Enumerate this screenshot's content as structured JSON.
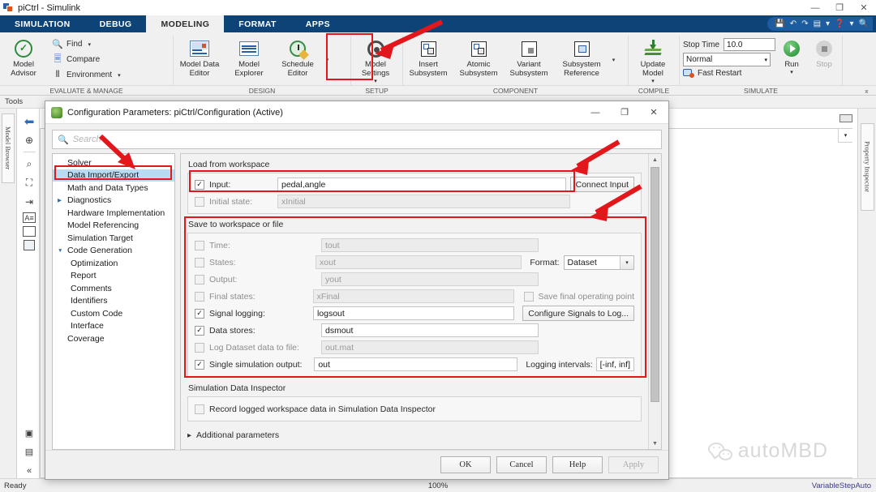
{
  "window": {
    "title": "piCtrl - Simulink",
    "minimize": "—",
    "maximize": "❐",
    "close": "✕"
  },
  "ribbon": {
    "tabs": [
      {
        "label": "SIMULATION",
        "active": false
      },
      {
        "label": "DEBUG",
        "active": false
      },
      {
        "label": "MODELING",
        "active": true
      },
      {
        "label": "FORMAT",
        "active": false
      },
      {
        "label": "APPS",
        "active": false
      }
    ],
    "quick_access": {
      "save": "save-icon",
      "undo": "↶",
      "redo": "↷",
      "layout": "layout-icon",
      "layout_caret": "▾",
      "help": "?",
      "help_caret": "▾",
      "search": "search-icon"
    },
    "groups": [
      {
        "label": "EVALUATE & MANAGE",
        "big": [
          {
            "label": "Model\nAdvisor",
            "caret": "▾",
            "icon": "check-circle-icon"
          }
        ],
        "small": [
          {
            "label": "Find",
            "icon": "magnifier-icon",
            "caret": "▾"
          },
          {
            "label": "Compare",
            "icon": "compare-icon",
            "caret": ""
          },
          {
            "label": "Environment",
            "icon": "sliders-icon",
            "caret": "▾"
          }
        ]
      },
      {
        "label": "DESIGN",
        "big": [
          {
            "label": "Model Data\nEditor",
            "icon": "model-data-editor-icon"
          },
          {
            "label": "Model\nExplorer",
            "icon": "model-explorer-icon"
          },
          {
            "label": "Schedule\nEditor",
            "icon": "schedule-editor-icon"
          }
        ],
        "flyout": "▾"
      },
      {
        "label": "SETUP",
        "big": [
          {
            "label": "Model\nSettings",
            "caret": "▾",
            "icon": "gear-icon"
          }
        ]
      },
      {
        "label": "COMPONENT",
        "big": [
          {
            "label": "Insert\nSubsystem",
            "icon": "insert-subsystem-icon"
          },
          {
            "label": "Atomic\nSubsystem",
            "icon": "atomic-subsystem-icon"
          },
          {
            "label": "Variant\nSubsystem",
            "icon": "variant-subsystem-icon"
          },
          {
            "label": "Subsystem\nReference",
            "icon": "subsystem-reference-icon"
          }
        ],
        "flyout": "▾"
      },
      {
        "label": "COMPILE",
        "big": [
          {
            "label": "Update\nModel",
            "caret": "▾",
            "icon": "update-model-icon"
          }
        ]
      },
      {
        "label": "SIMULATE",
        "stop_time_label": "Stop Time",
        "stop_time_value": "10.0",
        "sim_mode": "Normal",
        "sim_mode_caret": "▾",
        "fast_restart": "Fast Restart",
        "run_label": "Run",
        "run_caret": "▾",
        "stop_label": "Stop"
      }
    ],
    "collapse": "⌅"
  },
  "canvas": {
    "tools_label": "Tools",
    "left_tab": "Model Browser",
    "right_tab": "Property Inspector",
    "left_tools": [
      {
        "name": "back-arrow-icon",
        "glyph": "⬅"
      },
      {
        "name": "zoom-fit-target-icon",
        "glyph": "⊕"
      },
      {
        "name": "zoom-in-icon",
        "glyph": "🔍"
      },
      {
        "name": "fit-to-view-icon",
        "glyph": "⛶"
      },
      {
        "name": "signal-routing-icon",
        "glyph": "⇥"
      },
      {
        "name": "annotation-icon",
        "glyph": "A"
      },
      {
        "name": "image-icon",
        "glyph": "▣"
      },
      {
        "name": "area-icon",
        "glyph": "▢"
      },
      {
        "name": "camera-icon",
        "glyph": "📷"
      },
      {
        "name": "report-icon",
        "glyph": "▤"
      },
      {
        "name": "collapse-icon",
        "glyph": "«"
      }
    ],
    "watermark": "autoMBD",
    "dropdown_caret": "▾"
  },
  "status": {
    "left": "Ready",
    "zoom": "100%",
    "right": "VariableStepAuto"
  },
  "dialog": {
    "title": "Configuration Parameters: piCtrl/Configuration (Active)",
    "minimize": "—",
    "maximize": "❐",
    "close": "✕",
    "search": {
      "placeholder": "Search",
      "value": "",
      "icon": "search-icon"
    },
    "tree": [
      {
        "label": "Solver",
        "indent": 0,
        "arrow": "",
        "selected": false
      },
      {
        "label": "Data Import/Export",
        "indent": 0,
        "arrow": "",
        "selected": true
      },
      {
        "label": "Math and Data Types",
        "indent": 0,
        "arrow": "",
        "selected": false
      },
      {
        "label": "Diagnostics",
        "indent": 0,
        "arrow": "▶",
        "selected": false
      },
      {
        "label": "Hardware Implementation",
        "indent": 0,
        "arrow": "",
        "selected": false
      },
      {
        "label": "Model Referencing",
        "indent": 0,
        "arrow": "",
        "selected": false
      },
      {
        "label": "Simulation Target",
        "indent": 0,
        "arrow": "",
        "selected": false
      },
      {
        "label": "Code Generation",
        "indent": 0,
        "arrow": "▼",
        "selected": false
      },
      {
        "label": "Optimization",
        "indent": 1,
        "arrow": "",
        "selected": false
      },
      {
        "label": "Report",
        "indent": 1,
        "arrow": "",
        "selected": false
      },
      {
        "label": "Comments",
        "indent": 1,
        "arrow": "",
        "selected": false
      },
      {
        "label": "Identifiers",
        "indent": 1,
        "arrow": "",
        "selected": false
      },
      {
        "label": "Custom Code",
        "indent": 1,
        "arrow": "",
        "selected": false
      },
      {
        "label": "Interface",
        "indent": 1,
        "arrow": "",
        "selected": false
      },
      {
        "label": "Coverage",
        "indent": 0,
        "arrow": "",
        "selected": false
      }
    ],
    "load_section": {
      "title": "Load from workspace",
      "input": {
        "label": "Input:",
        "value": "pedal,angle",
        "checked": true,
        "enabled": true
      },
      "initial_state": {
        "label": "Initial state:",
        "value": "xInitial",
        "checked": false,
        "enabled": false
      },
      "connect_input_button": "Connect Input"
    },
    "save_section": {
      "title": "Save to workspace or file",
      "rows": [
        {
          "label": "Time:",
          "value": "tout",
          "checked": false,
          "enabled": false
        },
        {
          "label": "States:",
          "value": "xout",
          "checked": false,
          "enabled": false
        },
        {
          "label": "Output:",
          "value": "yout",
          "checked": false,
          "enabled": false
        },
        {
          "label": "Final states:",
          "value": "xFinal",
          "checked": false,
          "enabled": false
        },
        {
          "label": "Signal logging:",
          "value": "logsout",
          "checked": true,
          "enabled": true
        },
        {
          "label": "Data stores:",
          "value": "dsmout",
          "checked": true,
          "enabled": true
        },
        {
          "label": "Log Dataset data to file:",
          "value": "out.mat",
          "checked": false,
          "enabled": false
        },
        {
          "label": "Single simulation output:",
          "value": "out",
          "checked": true,
          "enabled": true
        }
      ],
      "format_label": "Format:",
      "format_value": "Dataset",
      "format_caret": "▾",
      "save_final_operating_point": {
        "label": "Save final operating point",
        "checked": false
      },
      "configure_signals_button": "Configure Signals to Log...",
      "logging_intervals_label": "Logging intervals:",
      "logging_intervals_value": "[-inf, inf]"
    },
    "sdi_section": {
      "title": "Simulation Data Inspector",
      "record_checkbox": {
        "label": "Record logged workspace data in Simulation Data Inspector",
        "checked": false
      }
    },
    "additional_parameters": {
      "label": "Additional parameters",
      "arrow": "▶"
    },
    "footer": {
      "ok": "OK",
      "cancel": "Cancel",
      "help": "Help",
      "apply": "Apply"
    },
    "scrollbar": {
      "up": "▲",
      "down": "▼"
    }
  },
  "annotations": {
    "accent_color": "#e3161c",
    "highlights": [
      "model-settings-button",
      "data-import-export-tree-node",
      "input-row",
      "save-to-workspace-section"
    ],
    "arrows": 4
  }
}
